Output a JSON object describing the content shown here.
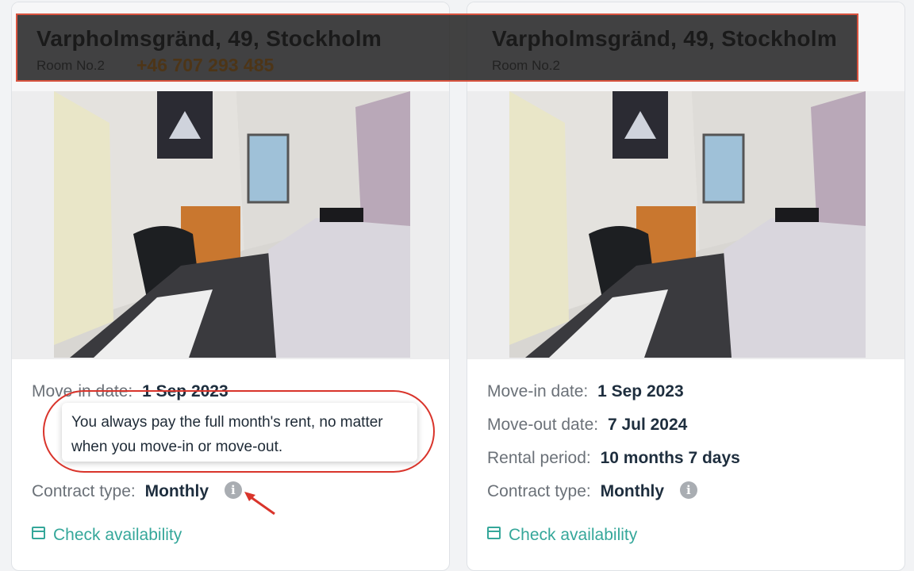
{
  "listings": [
    {
      "address": "Varpholmsgränd, 49, Stockholm",
      "room": "Room No.2",
      "phone": "+46 707 293 485",
      "move_in_label": "Move-in date:",
      "move_in": "1 Sep 2023",
      "contract_label": "Contract type:",
      "contract": "Monthly",
      "check_label": "Check availability"
    },
    {
      "address": "Varpholmsgränd, 49, Stockholm",
      "room": "Room No.2",
      "move_in_label": "Move-in date:",
      "move_in": "1 Sep 2023",
      "move_out_label": "Move-out date:",
      "move_out": "7 Jul 2024",
      "period_label": "Rental period:",
      "period": "10 months 7 days",
      "contract_label": "Contract type:",
      "contract": "Monthly",
      "check_label": "Check availability"
    }
  ],
  "tooltip": {
    "line1": "You always pay the full month's rent, no matter",
    "line2": "when you move-in or move-out."
  },
  "icons": {
    "info": "info-icon",
    "calendar": "calendar-icon"
  },
  "colors": {
    "accent": "#35a79a",
    "annotation_red": "#d9342b"
  }
}
